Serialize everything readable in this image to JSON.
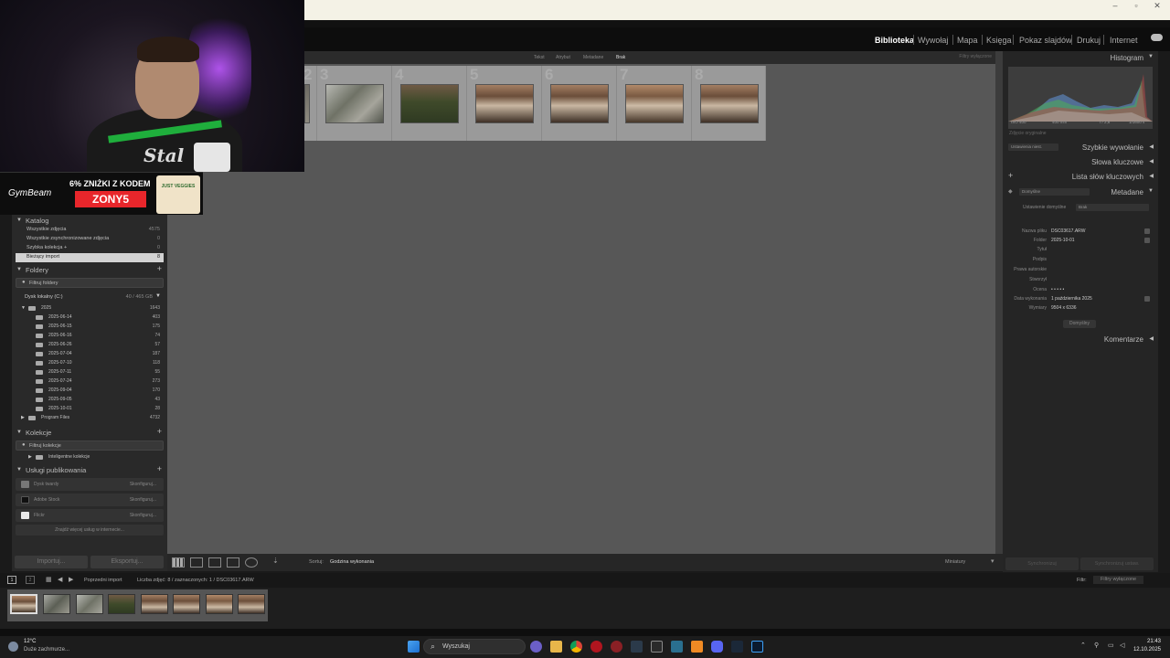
{
  "window": {
    "minimize": "–",
    "maximize": "▫",
    "close": "✕"
  },
  "modules": [
    "Biblioteka",
    "Wywołaj",
    "Mapa",
    "Księga",
    "Pokaz slajdów",
    "Drukuj",
    "Internet"
  ],
  "active_module": "Biblioteka",
  "webcam": {
    "shirt_logo": "Stal"
  },
  "ad": {
    "brand": "GymBeam",
    "promo": "6% ZNIŻKI Z KODEM",
    "code": "ZONY5",
    "product_label": "JUST VEGGIES"
  },
  "left_panel": {
    "catalog": {
      "title": "Katalog",
      "items": [
        {
          "label": "Wszystkie zdjęcia",
          "count": "4575"
        },
        {
          "label": "Wszystkie zsynchronizowane zdjęcia",
          "count": "0"
        },
        {
          "label": "Szybka kolekcja +",
          "count": "0"
        },
        {
          "label": "Bieżący import",
          "count": "8"
        }
      ]
    },
    "folders": {
      "title": "Foldery",
      "filter": "Filtruj foldery",
      "volume": {
        "label": "Dysk lokalny (C:)",
        "size": "40 / 465 GB"
      },
      "year": {
        "label": "2025",
        "count": "1643"
      },
      "items": [
        {
          "label": "2025-06-14",
          "count": "403"
        },
        {
          "label": "2025-06-15",
          "count": "175"
        },
        {
          "label": "2025-06-16",
          "count": "74"
        },
        {
          "label": "2025-06-26",
          "count": "57"
        },
        {
          "label": "2025-07-04",
          "count": "187"
        },
        {
          "label": "2025-07-10",
          "count": "118"
        },
        {
          "label": "2025-07-11",
          "count": "55"
        },
        {
          "label": "2025-07-24",
          "count": "273"
        },
        {
          "label": "2025-09-04",
          "count": "170"
        },
        {
          "label": "2025-09-05",
          "count": "43"
        },
        {
          "label": "2025-10-01",
          "count": "28"
        }
      ],
      "program_files": {
        "label": "Program Files",
        "count": "4732"
      }
    },
    "collections": {
      "title": "Kolekcje",
      "filter": "Filtruj kolekcje",
      "smart": "Inteligentne kolekcje"
    },
    "publish": {
      "title": "Usługi publikowania",
      "services": [
        {
          "label": "Dysk twardy",
          "action": "Skonfiguruj...",
          "color": "#777777"
        },
        {
          "label": "Adobe Stock",
          "action": "Skonfiguruj...",
          "color": "#101010"
        },
        {
          "label": "Flickr",
          "action": "Skonfiguruj...",
          "color": "#e8e8e8"
        }
      ],
      "more": "Znajdź więcej usług w internecie..."
    },
    "import_btn": "Importuj...",
    "export_btn": "Eksportuj..."
  },
  "filter_bar": {
    "items": [
      "Tekst",
      "Atrybut",
      "Metadane",
      "Brak"
    ],
    "active": "Brak",
    "right": "Filtry wyłączone"
  },
  "grid": {
    "cell_numbers": [
      "2",
      "3",
      "4",
      "5",
      "6",
      "7",
      "8"
    ]
  },
  "toolbar": {
    "sort_label": "Sortuj:",
    "sort_value": "Godzina wykonania",
    "thumbnails_label": "Miniatury"
  },
  "right_panel": {
    "histogram": {
      "title": "Histogram",
      "iso": "ISO 400",
      "focal": "400 mm",
      "aperture": "f / 2,8",
      "shutter": "1/1600 s",
      "original": "Zdjęcie oryginalne"
    },
    "quick_develop": {
      "title": "Szybkie wywołanie",
      "preset": "Ustawienia niest."
    },
    "keywords": {
      "title": "Słowa kluczowe"
    },
    "keyword_list": {
      "title": "Lista słów kluczowych"
    },
    "metadata": {
      "title": "Metadane",
      "view": "Domyślne",
      "preset_label": "Ustawienie domyślne",
      "preset_value": "Brak",
      "fields": [
        {
          "label": "Nazwa pliku",
          "value": "DSC03617.ARW"
        },
        {
          "label": "Folder",
          "value": "2025-10-01"
        },
        {
          "label": "Tytuł",
          "value": ""
        },
        {
          "label": "Podpis",
          "value": ""
        },
        {
          "label": "Prawa autorskie",
          "value": ""
        },
        {
          "label": "Stworzył",
          "value": ""
        },
        {
          "label": "Ocena",
          "value": "• • • • •"
        },
        {
          "label": "Data wykonania",
          "value": "1 października 2025"
        },
        {
          "label": "Wymiary",
          "value": "9504 x 6336"
        }
      ],
      "button": "Domyślny"
    },
    "comments": {
      "title": "Komentarze"
    },
    "sync_meta": "Synchronizuj",
    "sync_settings": "Synchronizuj ustaw."
  },
  "filmstrip": {
    "source": "Poprzedni import",
    "count_text": "Liczba zdjęć: 8 / zaznaczonych: 1 / DSC03617.ARW",
    "filter_label": "Filtr:",
    "filter_value": "Filtry wyłączone",
    "view1": "1",
    "view2": "2"
  },
  "taskbar": {
    "temperature": "12°C",
    "weather": "Duże zachmurze...",
    "search": "Wyszukaj",
    "time": "21:43",
    "date": "12.10.2025"
  }
}
